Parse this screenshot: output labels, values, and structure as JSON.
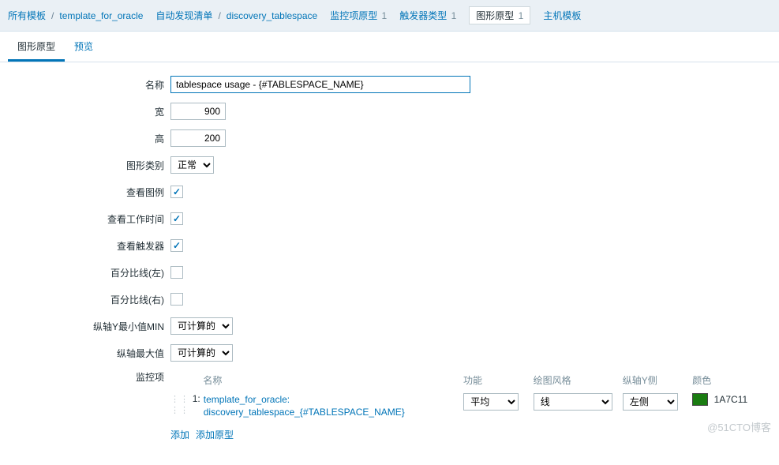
{
  "breadcrumb": {
    "all_templates": "所有模板",
    "template_name": "template_for_oracle",
    "discovery_list": "自动发现清单",
    "discovery_rule_name": "discovery_tablespace",
    "item_prototypes": "监控项原型",
    "item_prototypes_count": "1",
    "trigger_prototypes": "触发器类型",
    "trigger_prototypes_count": "1",
    "graph_prototypes": "图形原型",
    "graph_prototypes_count": "1",
    "host_templates": "主机模板"
  },
  "tabs": {
    "graph_prototype": "图形原型",
    "preview": "预览"
  },
  "form": {
    "name_label": "名称",
    "name_value": "tablespace usage - {#TABLESPACE_NAME}",
    "width_label": "宽",
    "width_value": "900",
    "height_label": "高",
    "height_value": "200",
    "graphtype_label": "图形类别",
    "graphtype_value": "正常",
    "show_legend_label": "查看图例",
    "show_work_label": "查看工作时间",
    "show_trig_label": "查看触发器",
    "percent_left_label": "百分比线(左)",
    "percent_right_label": "百分比线(右)",
    "ymin_label": "纵轴Y最小值MIN",
    "ymin_value": "可计算的",
    "ymax_label": "纵轴最大值",
    "ymax_value": "可计算的",
    "items_label": "监控项"
  },
  "items": {
    "head": {
      "name": "名称",
      "func": "功能",
      "draw": "绘图风格",
      "side": "纵轴Y侧",
      "color": "颜色"
    },
    "row": {
      "index": "1:",
      "name": "template_for_oracle: discovery_tablespace_{#TABLESPACE_NAME}",
      "func": "平均",
      "draw": "线",
      "side": "左侧",
      "color_hex": "1A7C11",
      "swatch_color": "#1A7C11"
    },
    "add": "添加",
    "add_prototype": "添加原型"
  },
  "watermark": "@51CTO博客"
}
